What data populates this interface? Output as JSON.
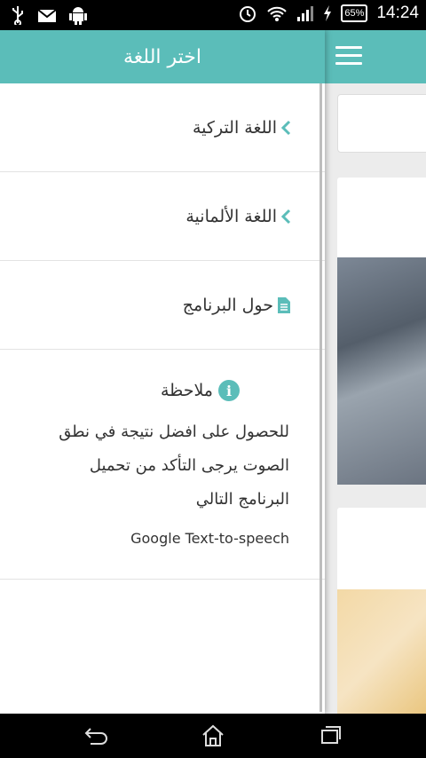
{
  "status_bar": {
    "time": "14:24",
    "battery": "65%"
  },
  "drawer": {
    "title": "اختر اللغة",
    "items": [
      {
        "label": "اللغة التركية",
        "icon": "chevron-icon"
      },
      {
        "label": "اللغة الألمانية",
        "icon": "chevron-icon"
      },
      {
        "label": "حول البرنامج",
        "icon": "document-icon"
      }
    ],
    "note": {
      "title": "ملاحظة",
      "lines": [
        "للحصول على افضل نتيجة في نطق",
        "الصوت يرجى التأكد من تحميل",
        "البرنامج التالي"
      ],
      "app_name": "Google Text-to-speech"
    }
  },
  "colors": {
    "accent": "#5bbdb9"
  }
}
